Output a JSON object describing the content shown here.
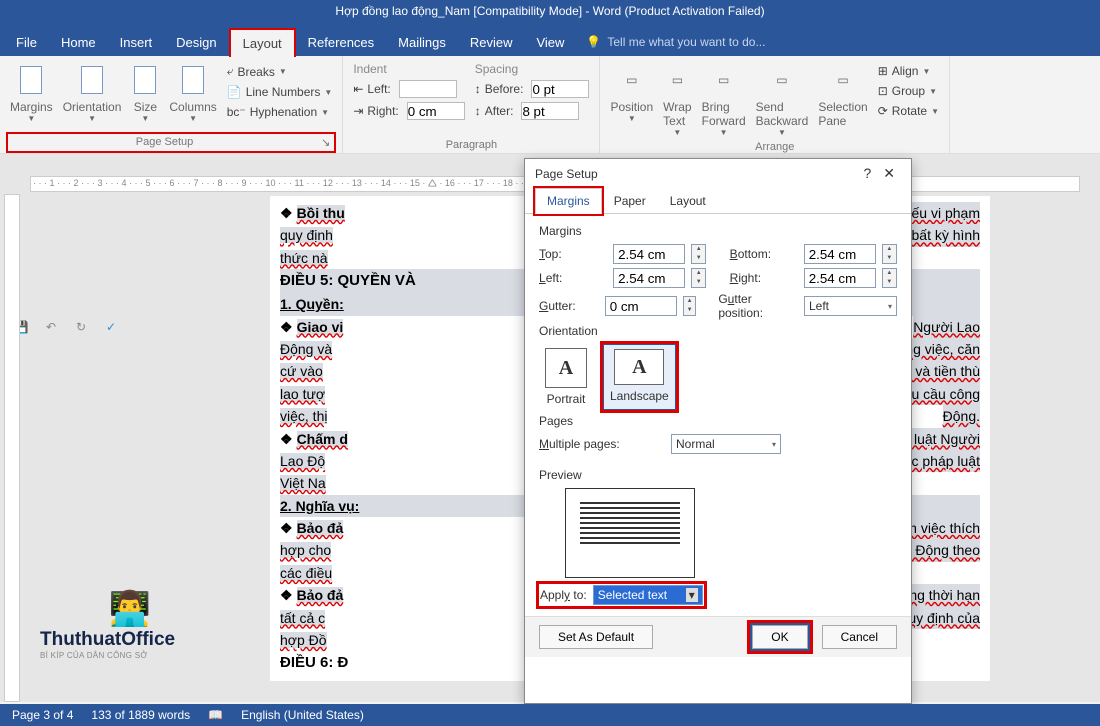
{
  "title": "Hợp đồng lao động_Nam [Compatibility Mode] - Word (Product Activation Failed)",
  "menu": {
    "file": "File",
    "home": "Home",
    "insert": "Insert",
    "design": "Design",
    "layout": "Layout",
    "references": "References",
    "mailings": "Mailings",
    "review": "Review",
    "view": "View",
    "tellme": "Tell me what you want to do..."
  },
  "ribbon": {
    "page_setup": {
      "margins": "Margins",
      "orientation": "Orientation",
      "size": "Size",
      "columns": "Columns",
      "breaks": "Breaks",
      "line_numbers": "Line Numbers",
      "hyphenation": "Hyphenation",
      "group": "Page Setup"
    },
    "paragraph": {
      "indent": "Indent",
      "left": "Left:",
      "right": "Right:",
      "left_val": "",
      "right_val": "0 cm",
      "spacing": "Spacing",
      "before": "Before:",
      "after": "After:",
      "before_val": "0 pt",
      "after_val": "8 pt",
      "group": "Paragraph"
    },
    "arrange": {
      "position": "Position",
      "wrap": "Wrap\nText",
      "bring": "Bring\nForward",
      "send": "Send\nBackward",
      "selection": "Selection\nPane",
      "align": "Align",
      "group_btn": "Group",
      "rotate": "Rotate",
      "group": "Arrange"
    }
  },
  "dialog": {
    "title": "Page Setup",
    "tabs": {
      "margins": "Margins",
      "paper": "Paper",
      "layout": "Layout"
    },
    "margins_section": "Margins",
    "top": "Top:",
    "bottom": "Bottom:",
    "left": "Left:",
    "right": "Right:",
    "gutter": "Gutter:",
    "gutter_pos": "Gutter position:",
    "top_val": "2.54 cm",
    "bottom_val": "2.54 cm",
    "left_val": "2.54 cm",
    "right_val": "2.54 cm",
    "gutter_val": "0 cm",
    "gutter_pos_val": "Left",
    "orientation": "Orientation",
    "portrait": "Portrait",
    "landscape": "Landscape",
    "pages": "Pages",
    "multiple": "Multiple pages:",
    "multiple_val": "Normal",
    "preview": "Preview",
    "apply": "Apply to:",
    "apply_val": "Selected text",
    "default": "Set As Default",
    "ok": "OK",
    "cancel": "Cancel"
  },
  "doc": {
    "l1": "Bồi thu",
    "l1b": "nếu vi phạm",
    "l2a": "quy định",
    "l2b": "bất kỳ hình",
    "l3": "thức nà",
    "s5": "ĐIỀU 5: QUYỀN VÀ",
    "q1": "1. Quyền:",
    "g1": "Giao vi",
    "g1b": "Người Lao",
    "g2": "Động và",
    "g2b": "ông việc, căn",
    "g3": "cứ vào",
    "g3b": "c và tiền thù",
    "g4": "lao tượ",
    "g4b": "êu cầu công",
    "g5": "việc, thị",
    "g5b": "Động.",
    "c1": "Chấm d",
    "c1b": "ý luật Người",
    "c2": "Lao Độ",
    "c2b": "ắc pháp luật",
    "c3": "Việt Na",
    "q2": "2. Nghĩa vụ:",
    "b1": "Bảo đả",
    "b1b": "m việc thích",
    "b2": "hợp cho",
    "b2b": "ao Động theo",
    "b3": "các điều",
    "b4": "Bảo đả",
    "b4b": "úng thời hạn",
    "b5": "tất cả c",
    "b5b": "quy định của",
    "b6": "hợp Đồ",
    "s6": "ĐIỀU 6: Đ"
  },
  "watermark": {
    "name": "ThuthuatOffice",
    "sub": "BÍ KÍP CỦA DÂN CÔNG SỞ"
  },
  "status": {
    "page": "Page 3 of 4",
    "words": "133 of 1889 words",
    "lang": "English (United States)"
  }
}
